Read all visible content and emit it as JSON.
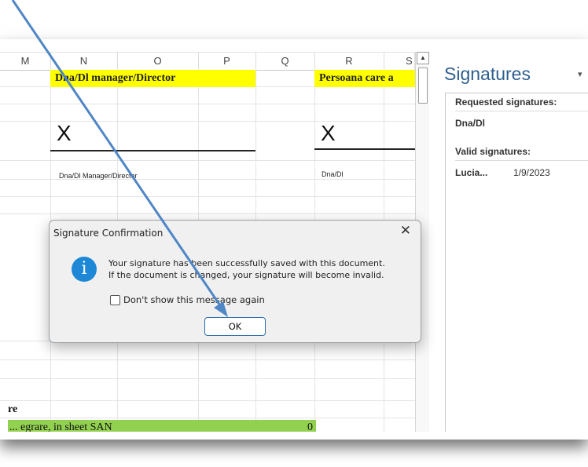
{
  "sheet": {
    "columns": [
      "M",
      "N",
      "O",
      "P",
      "Q",
      "R",
      "S"
    ],
    "signature_blocks": [
      {
        "header": "Dna/Dl manager/Director",
        "x_mark": "X",
        "caption": "Dna/Dl Manager/Director"
      },
      {
        "header": "Persoana care a",
        "x_mark": "X",
        "caption": "Dna/Dl"
      }
    ],
    "bottom_label": "re",
    "green_row_text": "... egrare, in sheet SAN",
    "green_row_value": "0"
  },
  "pane": {
    "title": "Signatures",
    "dropdown_icon": "▾",
    "requested_heading": "Requested signatures:",
    "requested_items": [
      "Dna/Dl"
    ],
    "valid_heading": "Valid signatures:",
    "valid_items": [
      {
        "name": "Lucia...",
        "date": "1/9/2023"
      }
    ]
  },
  "dialog": {
    "title": "Signature Confirmation",
    "close_icon": "✕",
    "icon_glyph": "i",
    "message_line1": "Your signature has been successfully saved with this document.",
    "message_line2": "If the document is changed, your signature will become invalid.",
    "checkbox_label": "Don't show this message again",
    "ok_label": "OK"
  },
  "colors": {
    "header_yellow": "#ffff00",
    "row_green": "#92d050",
    "pane_title_blue": "#2f5f8f",
    "info_blue": "#1e88d6",
    "annotation_arrow": "#4f86c6"
  }
}
